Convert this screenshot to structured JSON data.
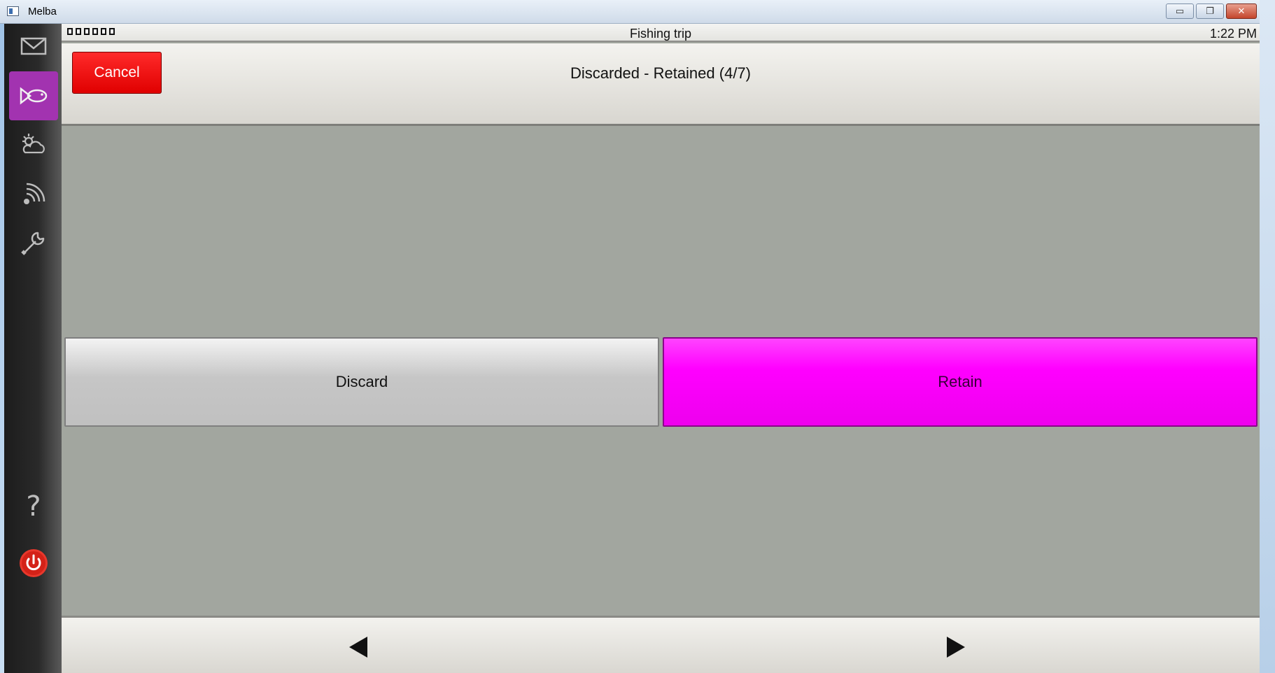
{
  "window": {
    "title": "Melba",
    "controls": {
      "minimize": "▭",
      "restore": "❐",
      "close": "✕"
    }
  },
  "sidebar": {
    "items": [
      {
        "icon": "mail-icon",
        "active": false
      },
      {
        "icon": "fish-icon",
        "active": true
      },
      {
        "icon": "weather-icon",
        "active": false
      },
      {
        "icon": "signal-icon",
        "active": false
      },
      {
        "icon": "wrench-icon",
        "active": false
      },
      {
        "icon": "help-icon",
        "active": false
      },
      {
        "icon": "power-icon",
        "active": false
      }
    ],
    "help_label": "?"
  },
  "status_bar": {
    "title": "Fishing trip",
    "time": "1:22 PM"
  },
  "header": {
    "cancel_label": "Cancel",
    "title": "Discarded - Retained (4/7)"
  },
  "choices": {
    "discard_label": "Discard",
    "retain_label": "Retain",
    "selected": "Retain"
  },
  "colors": {
    "accent_active": "#a233b0",
    "retain": "#ff00ff",
    "cancel": "#ff0000",
    "background": "#a2a69f"
  }
}
